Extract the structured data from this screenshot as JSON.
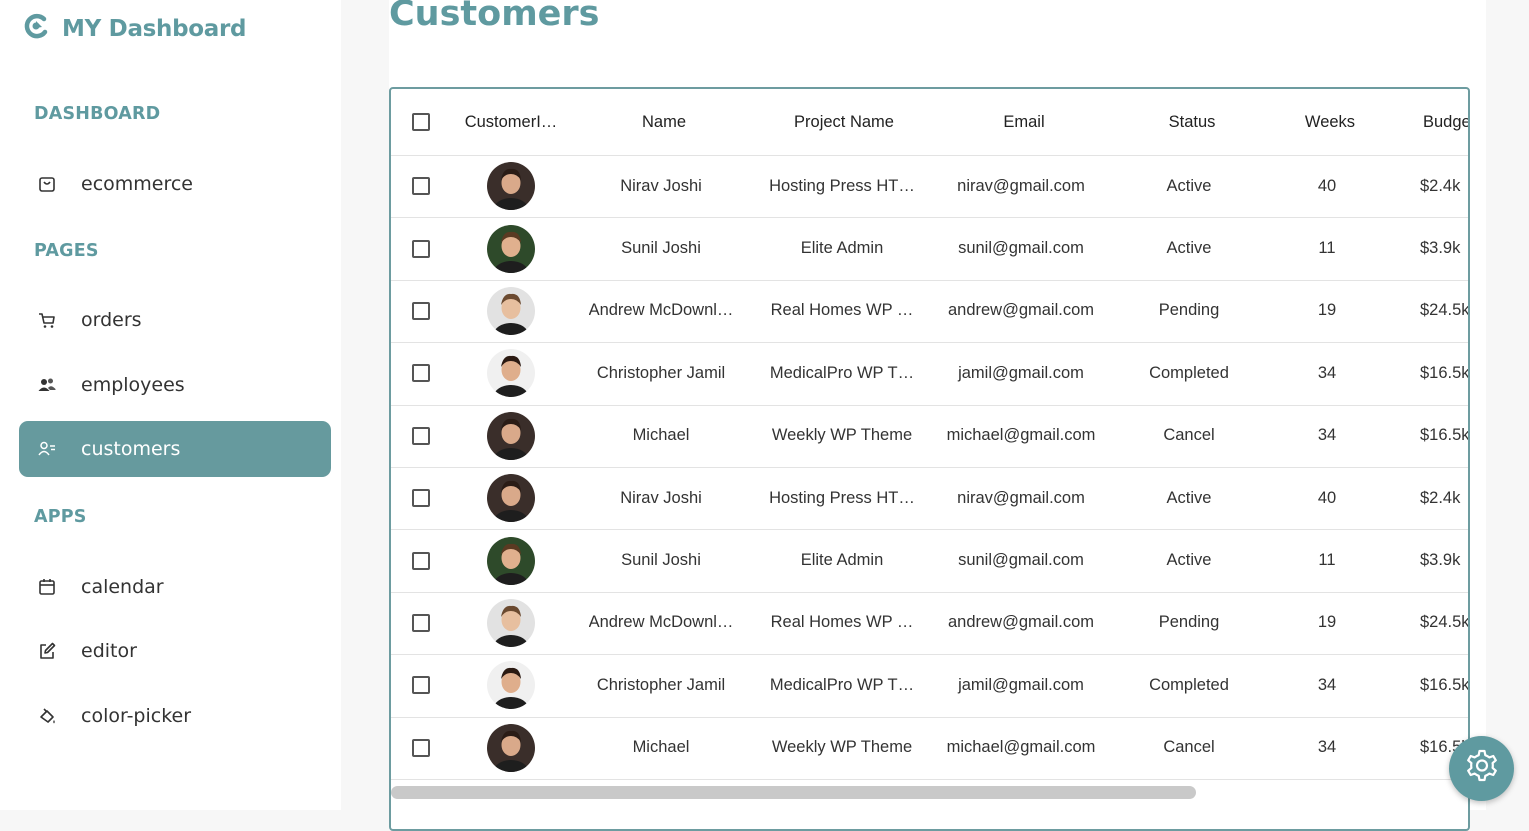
{
  "brand": {
    "title": "MY Dashboard",
    "icon": "logo-icon"
  },
  "sidebar": {
    "sections": [
      {
        "title": "DASHBOARD",
        "items": [
          {
            "label": "ecommerce",
            "icon": "shopping-bag-icon"
          }
        ]
      },
      {
        "title": "PAGES",
        "items": [
          {
            "label": "orders",
            "icon": "cart-icon"
          },
          {
            "label": "employees",
            "icon": "people-icon"
          },
          {
            "label": "customers",
            "icon": "customer-list-icon",
            "active": true
          }
        ]
      },
      {
        "title": "APPS",
        "items": [
          {
            "label": "calendar",
            "icon": "calendar-icon"
          },
          {
            "label": "editor",
            "icon": "edit-icon"
          },
          {
            "label": "color-picker",
            "icon": "paint-bucket-icon"
          }
        ]
      }
    ]
  },
  "page": {
    "title": "Customers"
  },
  "table": {
    "columns": [
      "CustomerI…",
      "Name",
      "Project Name",
      "Email",
      "Status",
      "Weeks",
      "Budge"
    ],
    "rows": [
      {
        "name": "Nirav Joshi",
        "project": "Hosting Press HT…",
        "email": "nirav@gmail.com",
        "status": "Active",
        "weeks": "40",
        "budget": "$2.4k"
      },
      {
        "name": "Sunil Joshi",
        "project": "Elite Admin",
        "email": "sunil@gmail.com",
        "status": "Active",
        "weeks": "11",
        "budget": "$3.9k"
      },
      {
        "name": "Andrew McDownl…",
        "project": "Real Homes WP …",
        "email": "andrew@gmail.com",
        "status": "Pending",
        "weeks": "19",
        "budget": "$24.5k"
      },
      {
        "name": "Christopher Jamil",
        "project": "MedicalPro WP T…",
        "email": "jamil@gmail.com",
        "status": "Completed",
        "weeks": "34",
        "budget": "$16.5k"
      },
      {
        "name": "Michael",
        "project": "Weekly WP Theme",
        "email": "michael@gmail.com",
        "status": "Cancel",
        "weeks": "34",
        "budget": "$16.5k"
      },
      {
        "name": "Nirav Joshi",
        "project": "Hosting Press HT…",
        "email": "nirav@gmail.com",
        "status": "Active",
        "weeks": "40",
        "budget": "$2.4k"
      },
      {
        "name": "Sunil Joshi",
        "project": "Elite Admin",
        "email": "sunil@gmail.com",
        "status": "Active",
        "weeks": "11",
        "budget": "$3.9k"
      },
      {
        "name": "Andrew McDownl…",
        "project": "Real Homes WP …",
        "email": "andrew@gmail.com",
        "status": "Pending",
        "weeks": "19",
        "budget": "$24.5k"
      },
      {
        "name": "Christopher Jamil",
        "project": "MedicalPro WP T…",
        "email": "jamil@gmail.com",
        "status": "Completed",
        "weeks": "34",
        "budget": "$16.5k"
      },
      {
        "name": "Michael",
        "project": "Weekly WP Theme",
        "email": "michael@gmail.com",
        "status": "Cancel",
        "weeks": "34",
        "budget": "$16.5k"
      }
    ]
  },
  "settings": {
    "icon": "gear-icon"
  },
  "colors": {
    "accent": "#5f9aa0",
    "active_bg": "#669a9e",
    "border": "#6d9ca0"
  }
}
